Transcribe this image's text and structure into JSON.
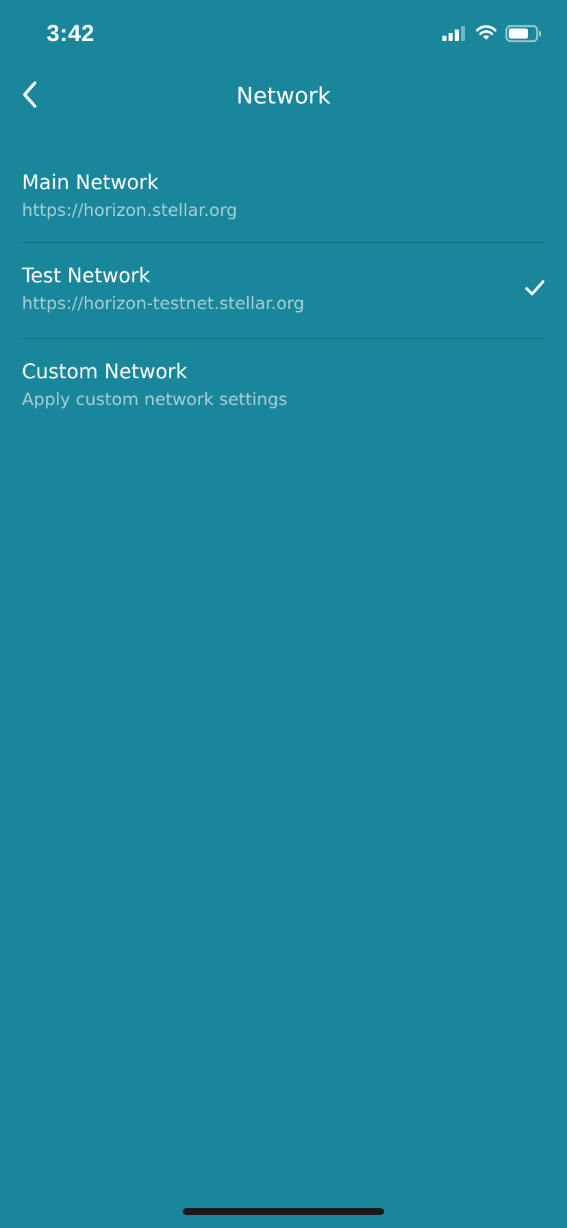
{
  "status_bar": {
    "time": "3:42",
    "icons": [
      "cellular-signal-icon",
      "wifi-icon",
      "battery-icon"
    ]
  },
  "nav": {
    "back_icon": "chevron-left-icon",
    "title": "Network"
  },
  "networks": [
    {
      "title": "Main Network",
      "subtitle": "https://horizon.stellar.org",
      "selected": false
    },
    {
      "title": "Test Network",
      "subtitle": "https://horizon-testnet.stellar.org",
      "selected": true
    },
    {
      "title": "Custom Network",
      "subtitle": "Apply custom network settings",
      "selected": false
    }
  ],
  "colors": {
    "background": "#1a869b",
    "divider": "#146e80",
    "subtitle": "#a7cfd8",
    "text": "#ffffff"
  }
}
